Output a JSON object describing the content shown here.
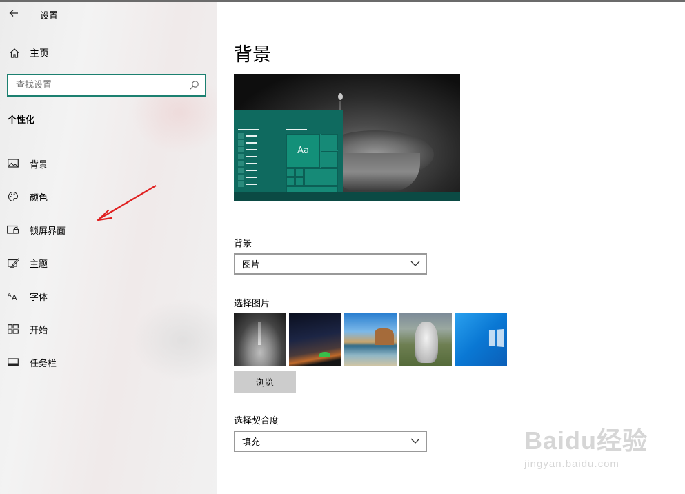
{
  "window": {
    "title": "设置"
  },
  "sidebar": {
    "home_label": "主页",
    "search": {
      "placeholder": "查找设置"
    },
    "section_title": "个性化",
    "items": [
      {
        "label": "背景",
        "icon": "picture-icon"
      },
      {
        "label": "颜色",
        "icon": "palette-icon"
      },
      {
        "label": "锁屏界面",
        "icon": "lock-screen-icon"
      },
      {
        "label": "主题",
        "icon": "theme-icon"
      },
      {
        "label": "字体",
        "icon": "font-icon"
      },
      {
        "label": "开始",
        "icon": "start-icon"
      },
      {
        "label": "任务栏",
        "icon": "taskbar-icon"
      }
    ]
  },
  "main": {
    "title": "背景",
    "preview": {
      "tile_label": "Aa"
    },
    "background_field": {
      "label": "背景",
      "value": "图片"
    },
    "choose_picture": {
      "label": "选择图片",
      "browse_label": "浏览"
    },
    "fit_field": {
      "label": "选择契合度",
      "value": "填充"
    }
  },
  "watermark": {
    "brand": "Baidu经验",
    "url": "jingyan.baidu.com"
  },
  "colors": {
    "accent": "#1c8070",
    "sidebar_bg": "#f0f0f0",
    "annotation_arrow": "#e02020",
    "button_bg": "#cccccc"
  }
}
